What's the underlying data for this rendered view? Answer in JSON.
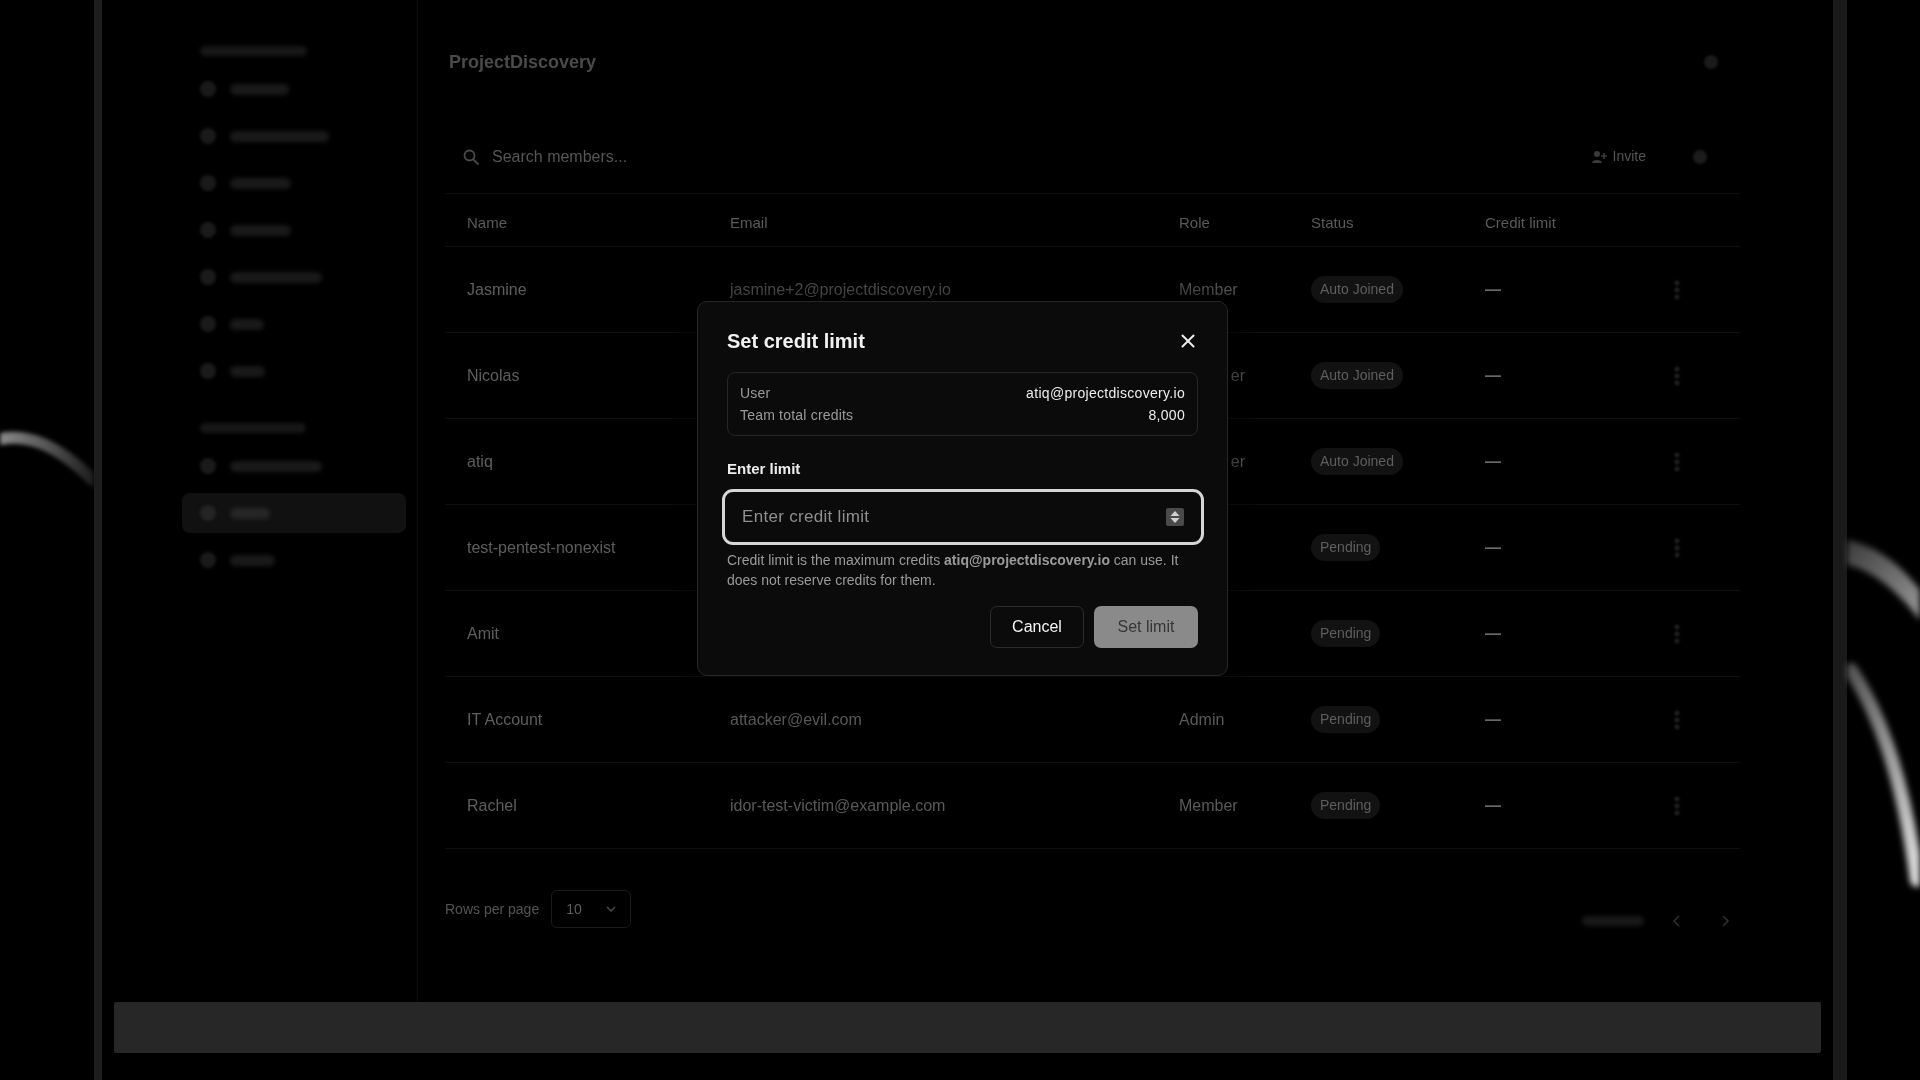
{
  "sidebar": {
    "sections": [
      {
        "items": [
          {
            "selected": false
          },
          {
            "selected": false
          },
          {
            "selected": false
          },
          {
            "selected": false
          },
          {
            "selected": false
          },
          {
            "selected": false
          },
          {
            "selected": false
          }
        ]
      },
      {
        "items": [
          {
            "selected": false
          },
          {
            "selected": true
          },
          {
            "selected": false
          }
        ]
      }
    ]
  },
  "header": {
    "title": "ProjectDiscovery"
  },
  "toolbar": {
    "search": {
      "placeholder": "Search members..."
    },
    "invite_button": "Invite"
  },
  "table": {
    "columns": [
      "Name",
      "Email",
      "Role",
      "Status",
      "Credit limit"
    ],
    "rows": [
      {
        "name": "Jasmine",
        "email": "jasmine+2@projectdiscovery.io",
        "role": "Member",
        "role_covered": false,
        "status": "Auto Joined",
        "credit_limit": "—"
      },
      {
        "name": "Nicolas",
        "role": "er",
        "role_covered": true,
        "status": "Auto Joined",
        "credit_limit": "—"
      },
      {
        "name": "atiq",
        "role": "er",
        "role_covered": true,
        "status": "Auto Joined",
        "credit_limit": "—"
      },
      {
        "name": "test-pentest-nonexist",
        "status": "Pending",
        "credit_limit": "—"
      },
      {
        "name": "Amit",
        "status": "Pending",
        "credit_limit": "—"
      },
      {
        "name": "IT Account",
        "email": "attacker@evil.com",
        "role": "Admin",
        "role_covered": false,
        "status": "Pending",
        "credit_limit": "—"
      },
      {
        "name": "Rachel",
        "email": "idor-test-victim@example.com",
        "role": "Member",
        "role_covered": false,
        "status": "Pending",
        "credit_limit": "—"
      }
    ]
  },
  "pagination": {
    "rows_per_page_label": "Rows per page",
    "rows_per_page": "10"
  },
  "dialog": {
    "title": "Set credit limit",
    "info": [
      {
        "label": "User",
        "value": "atiq@projectdiscovery.io"
      },
      {
        "label": "Team total credits",
        "value": "8,000"
      }
    ],
    "field_label": "Enter limit",
    "field": {
      "placeholder": "Enter credit limit",
      "focused": true
    },
    "help": "Credit limit is the maximum credits **atiq@projectdiscovery.io** can use. It does not reserve credits for them.",
    "buttons": [
      {
        "label": "Cancel",
        "kind": "secondary",
        "disabled": false
      },
      {
        "label": "Set limit",
        "kind": "primary",
        "disabled": true
      }
    ]
  }
}
